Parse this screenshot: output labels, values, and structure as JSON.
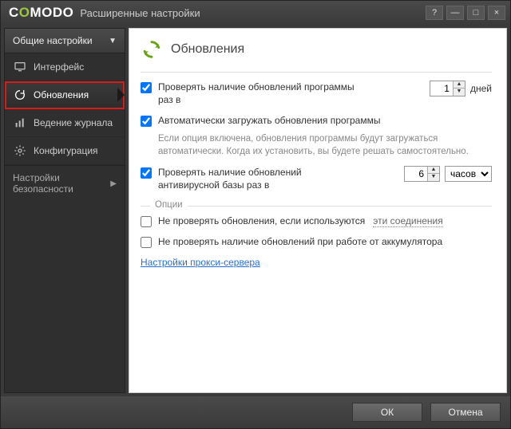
{
  "titlebar": {
    "brand": "COMODO",
    "subtitle": "Расширенные настройки"
  },
  "sidebar": {
    "general_label": "Общие настройки",
    "items": [
      {
        "label": "Интерфейс"
      },
      {
        "label": "Обновления"
      },
      {
        "label": "Ведение журнала"
      },
      {
        "label": "Конфигурация"
      }
    ],
    "security_label": "Настройки безопасности"
  },
  "page": {
    "title": "Обновления",
    "check_program": {
      "checked": true,
      "label": "Проверять наличие обновлений программы раз в",
      "value": "1",
      "unit": "дней"
    },
    "auto_download": {
      "checked": true,
      "label": "Автоматически загружать обновления программы",
      "hint": "Если опция включена, обновления программы будут загружаться автоматически. Когда их установить, вы будете решать самостоятельно."
    },
    "check_av": {
      "checked": true,
      "label": "Проверять наличие обновлений антивирусной базы раз в",
      "value": "6",
      "unit": "часов"
    },
    "options_legend": "Опции",
    "skip_connections": {
      "checked": false,
      "label": "Не проверять обновления, если используются",
      "link": "эти соединения"
    },
    "skip_battery": {
      "checked": false,
      "label": "Не проверять наличие обновлений при работе от аккумулятора"
    },
    "proxy_link": "Настройки прокси-сервера"
  },
  "footer": {
    "ok": "ОК",
    "cancel": "Отмена"
  }
}
